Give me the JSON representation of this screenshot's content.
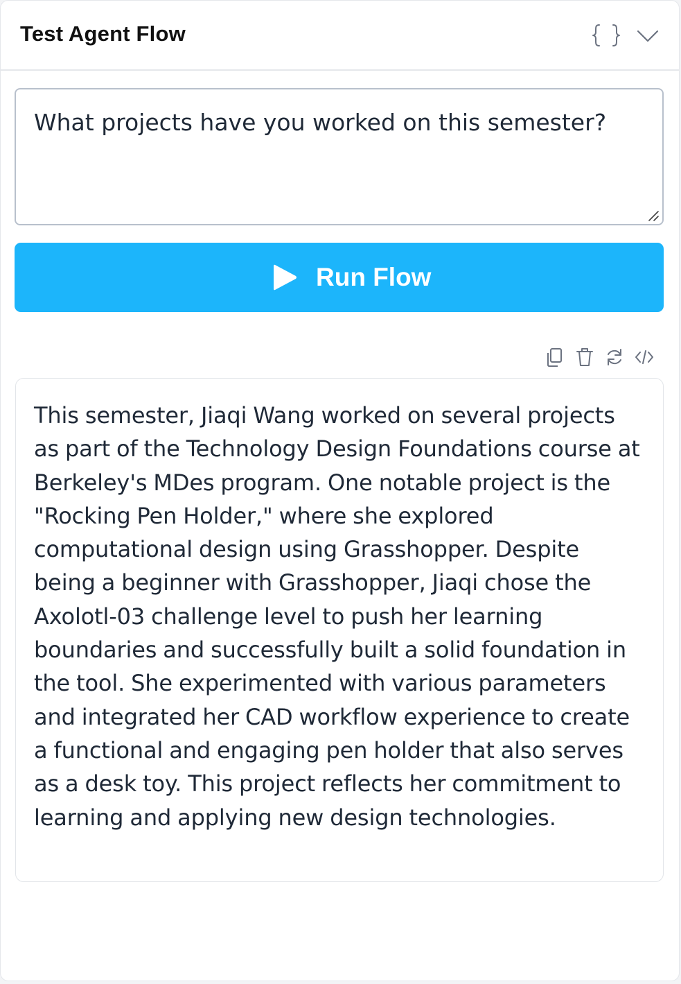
{
  "header": {
    "title": "Test Agent Flow",
    "icons": [
      "braces-icon",
      "chevron-down-icon"
    ]
  },
  "prompt": {
    "value": "What projects have you worked on this semester?"
  },
  "run_button": {
    "label": "Run Flow",
    "icon": "play-icon",
    "color": "#1cb5fb"
  },
  "output_toolbar": {
    "icons": [
      "copy-icon",
      "trash-icon",
      "refresh-icon",
      "code-icon"
    ]
  },
  "output": {
    "text": "This semester, Jiaqi Wang worked on several projects as part of the Technology Design Foundations course at Berkeley's MDes program. One notable project is the \"Rocking Pen Holder,\" where she explored computational design using Grasshopper. Despite being a beginner with Grasshopper, Jiaqi chose the Axolotl-03 challenge level to push her learning boundaries and successfully built a solid foundation in the tool. She experimented with various parameters and integrated her CAD workflow experience to create a functional and engaging pen holder that also serves as a desk toy. This project reflects her commitment to learning and applying new design technologies."
  }
}
